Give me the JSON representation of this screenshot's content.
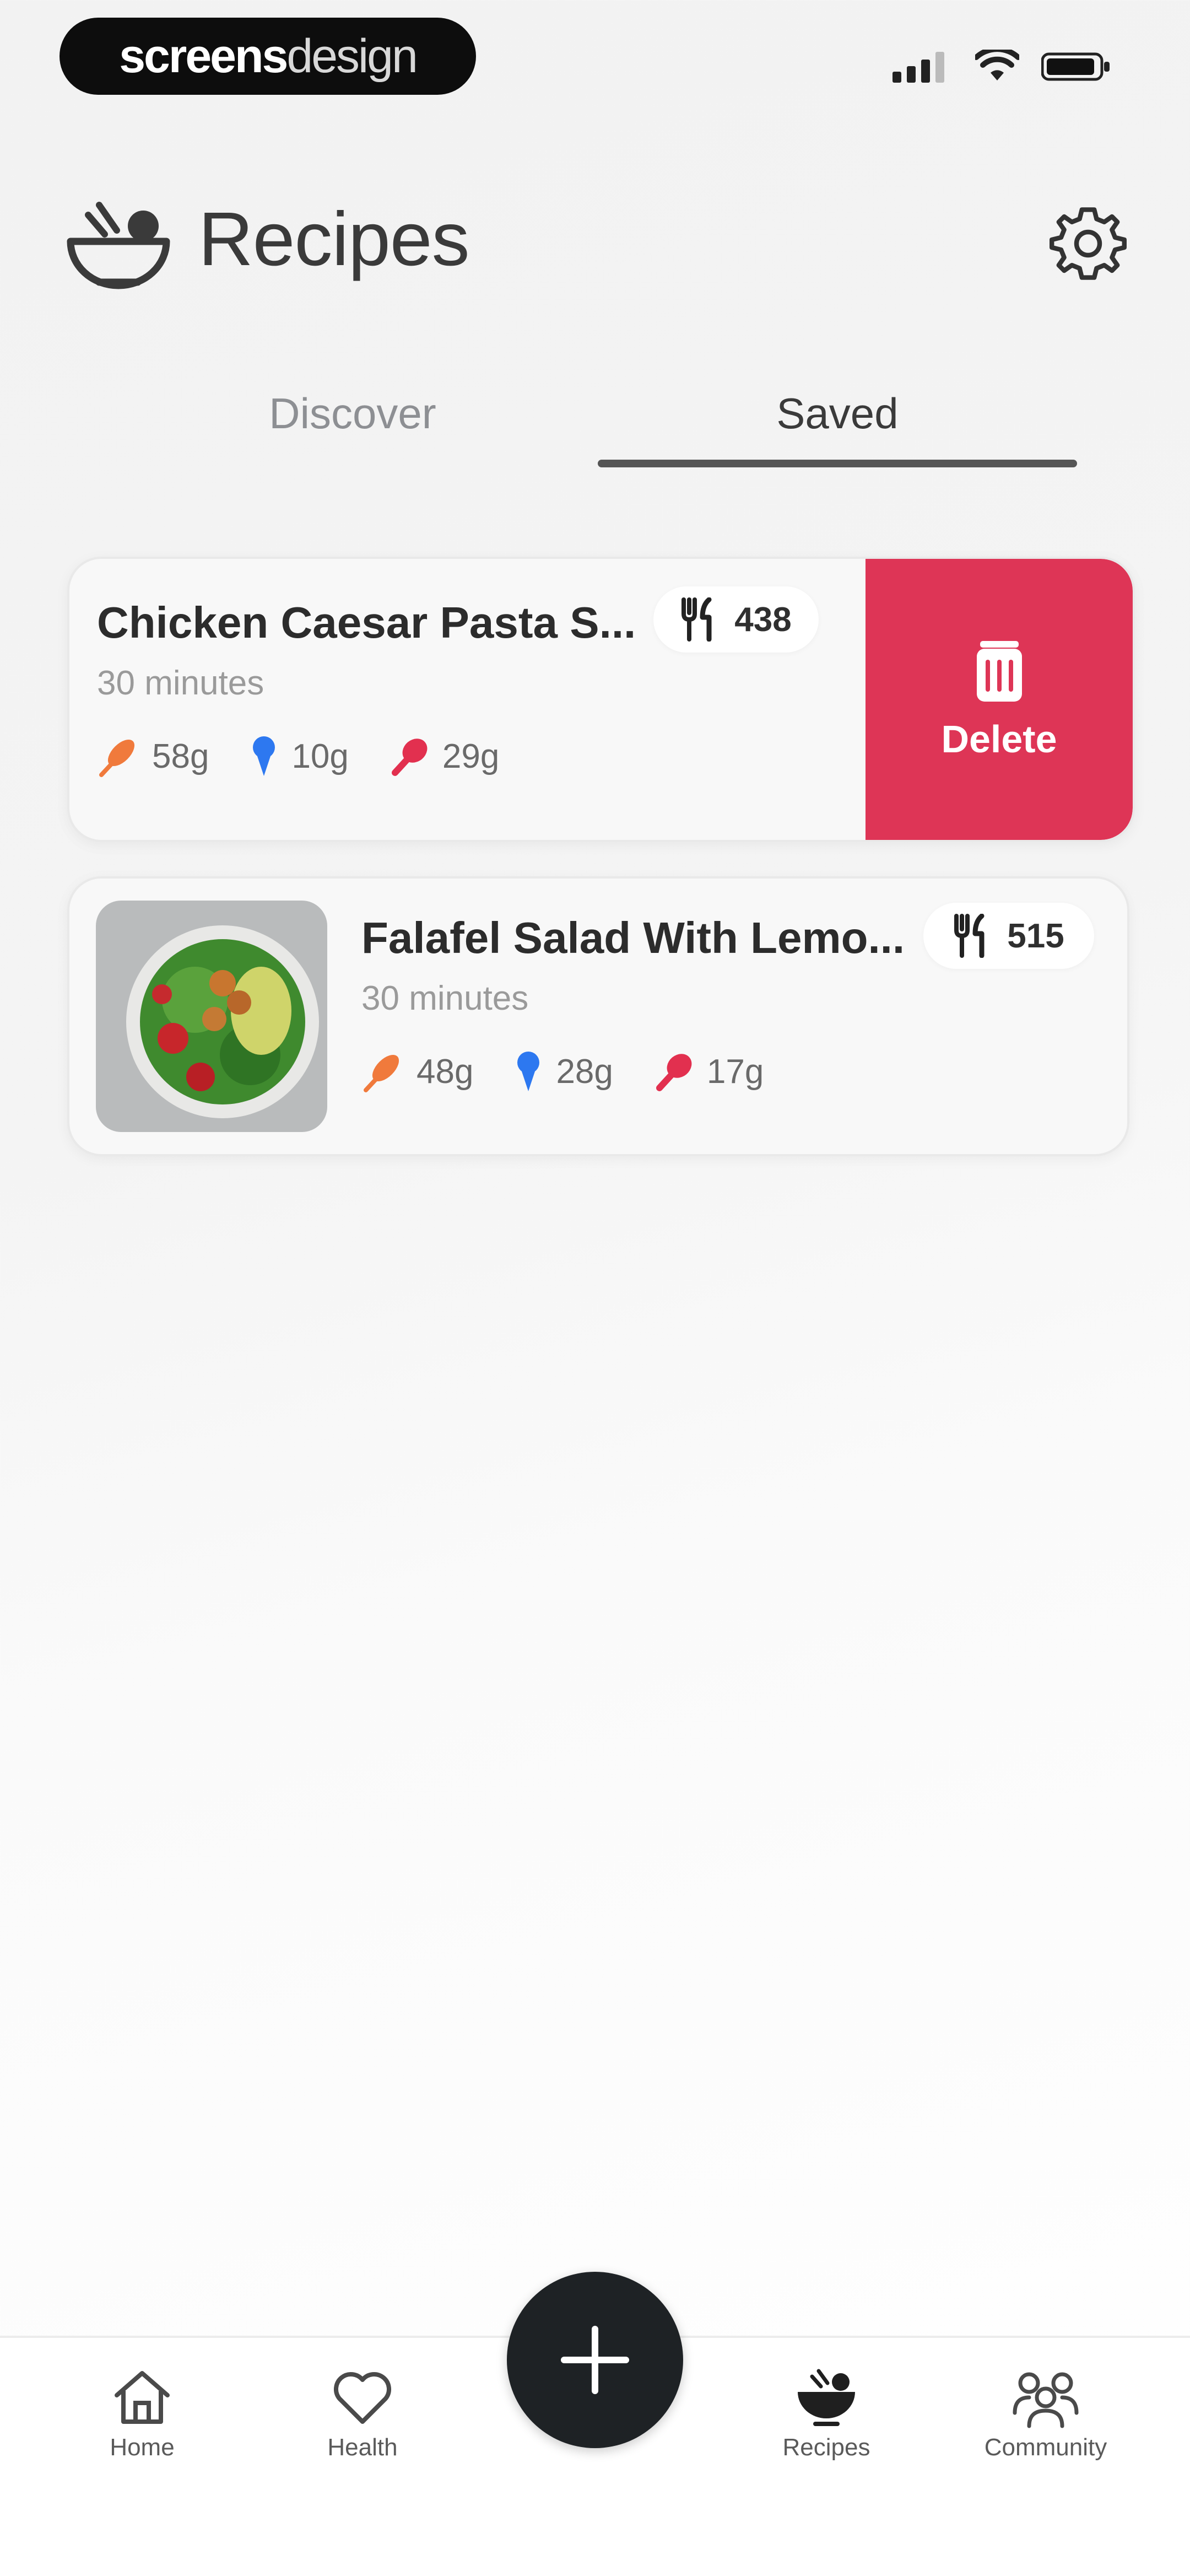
{
  "status_bar": {
    "brand_strong": "screens",
    "brand_light": "design"
  },
  "header": {
    "title": "Recipes"
  },
  "tabs": [
    {
      "label": "Discover",
      "active": false
    },
    {
      "label": "Saved",
      "active": true
    }
  ],
  "saved_recipes": [
    {
      "name": "Chicken Caesar Pasta S...",
      "time": "30 minutes",
      "kcal": "438",
      "carbs": "58g",
      "fat": "10g",
      "protein": "29g",
      "swipe_action_label": "Delete"
    },
    {
      "name": "Falafel Salad With Lemo...",
      "time": "30 minutes",
      "kcal": "515",
      "carbs": "48g",
      "fat": "28g",
      "protein": "17g"
    }
  ],
  "bottom_nav": [
    {
      "label": "Home",
      "icon": "home-icon"
    },
    {
      "label": "Health",
      "icon": "heart-icon"
    },
    {
      "label": "Recipes",
      "icon": "bowl-icon",
      "active": true
    },
    {
      "label": "Community",
      "icon": "community-icon"
    }
  ],
  "colors": {
    "delete": "#de3556",
    "carbs": "#f07a3c",
    "fat": "#2d78f0",
    "protein": "#e2304f",
    "fab": "#1e2225"
  }
}
